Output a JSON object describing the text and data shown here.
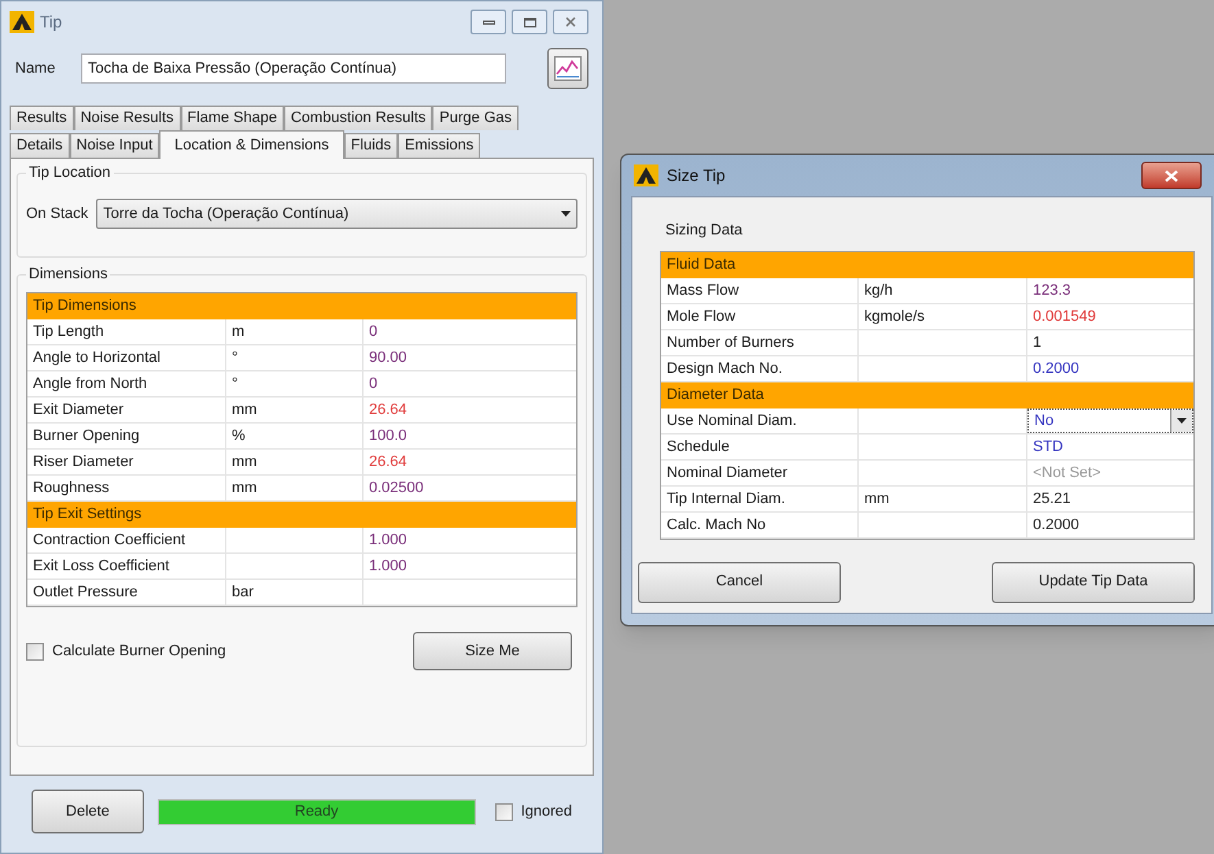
{
  "window": {
    "title": "Tip"
  },
  "name_field": {
    "label": "Name",
    "value": "Tocha de Baixa Pressão (Operação Contínua)"
  },
  "tabs_top": [
    {
      "label": "Results",
      "selected": false
    },
    {
      "label": "Noise Results",
      "selected": false
    },
    {
      "label": "Flame Shape",
      "selected": false
    },
    {
      "label": "Combustion Results",
      "selected": false
    },
    {
      "label": "Purge Gas",
      "selected": false
    }
  ],
  "tabs_bottom": [
    {
      "label": "Details",
      "selected": false
    },
    {
      "label": "Noise Input",
      "selected": false
    },
    {
      "label": "Location & Dimensions",
      "selected": true
    },
    {
      "label": "Fluids",
      "selected": false
    },
    {
      "label": "Emissions",
      "selected": false
    }
  ],
  "tip_location": {
    "title": "Tip Location",
    "label": "On Stack",
    "value": "Torre da Tocha (Operação Contínua)"
  },
  "dimensions": {
    "title": "Dimensions",
    "rows": [
      {
        "kind": "section",
        "label": "Tip Dimensions"
      },
      {
        "kind": "value",
        "label": "Tip Length",
        "unit": "m",
        "value": "0",
        "color": "#7a2f7a"
      },
      {
        "kind": "value",
        "label": "Angle to Horizontal",
        "unit": "°",
        "value": "90.00",
        "color": "#7a2f7a"
      },
      {
        "kind": "value",
        "label": "Angle from North",
        "unit": "°",
        "value": "0",
        "color": "#7a2f7a"
      },
      {
        "kind": "value",
        "label": "Exit Diameter",
        "unit": "mm",
        "value": "26.64",
        "color": "#e03a3a"
      },
      {
        "kind": "value",
        "label": "Burner Opening",
        "unit": "%",
        "value": "100.0",
        "color": "#7a2f7a"
      },
      {
        "kind": "value",
        "label": "Riser Diameter",
        "unit": "mm",
        "value": "26.64",
        "color": "#e03a3a"
      },
      {
        "kind": "value",
        "label": "Roughness",
        "unit": "mm",
        "value": "0.02500",
        "color": "#7a2f7a"
      },
      {
        "kind": "section",
        "label": "Tip Exit Settings"
      },
      {
        "kind": "value",
        "label": "Contraction Coefficient",
        "value": "1.000",
        "color": "#7a2f7a"
      },
      {
        "kind": "value",
        "label": "Exit Loss Coefficient",
        "value": "1.000",
        "color": "#7a2f7a"
      },
      {
        "kind": "value",
        "label": "Outlet Pressure",
        "unit": "bar"
      }
    ]
  },
  "calculate_checkbox": {
    "label": "Calculate Burner Opening",
    "checked": false
  },
  "size_button": "Size Me",
  "delete_button": "Delete",
  "status": {
    "text": "Ready",
    "level": 1
  },
  "ignored_checkbox": {
    "label": "Ignored",
    "checked": false
  },
  "dialog": {
    "title": "Size Tip",
    "group": "Sizing Data",
    "rows": [
      {
        "kind": "section",
        "label": "Fluid Data"
      },
      {
        "kind": "value",
        "label": "Mass Flow",
        "unit": "kg/h",
        "value": "123.3",
        "color": "#7a2f7a"
      },
      {
        "kind": "value",
        "label": "Mole Flow",
        "unit": "kgmole/s",
        "value": "0.001549",
        "color": "#e03a3a"
      },
      {
        "kind": "value",
        "label": "Number of Burners",
        "value": "1",
        "color": "#222222"
      },
      {
        "kind": "value",
        "label": "Design Mach No.",
        "value": "0.2000",
        "color": "#3535c0"
      },
      {
        "kind": "section",
        "label": "Diameter Data"
      },
      {
        "kind": "dropdown",
        "label": "Use Nominal Diam.",
        "value": "No",
        "color": "#3535c0"
      },
      {
        "kind": "value",
        "label": "Schedule",
        "value": "STD",
        "color": "#3535c0"
      },
      {
        "kind": "value",
        "label": "Nominal Diameter",
        "value": "<Not Set>",
        "color": "#999999"
      },
      {
        "kind": "value",
        "label": "Tip Internal Diam.",
        "unit": "mm",
        "value": "25.21",
        "color": "#222222"
      },
      {
        "kind": "value",
        "label": "Calc. Mach No",
        "value": "0.2000",
        "color": "#222222"
      }
    ],
    "buttons": [
      "Cancel",
      "Update Tip Data"
    ]
  }
}
